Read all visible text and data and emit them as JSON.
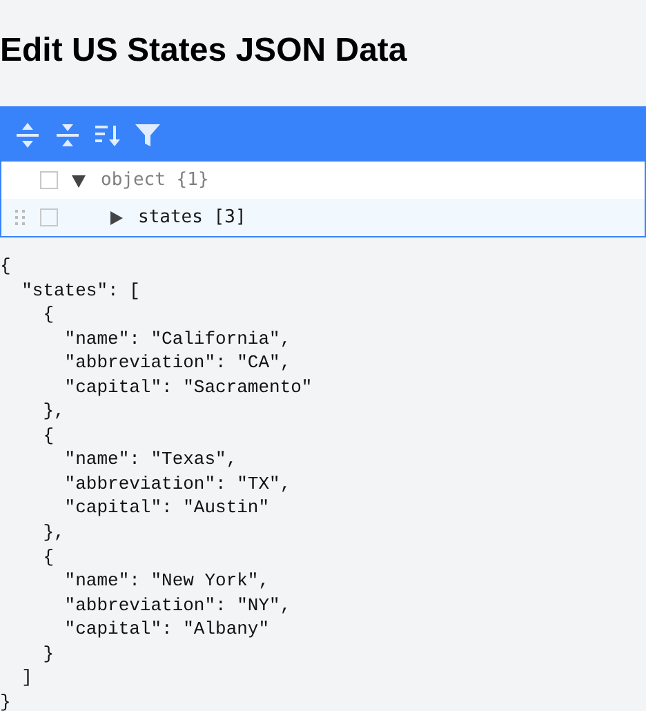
{
  "title": "Edit US States JSON Data",
  "toolbar": {
    "buttons": [
      {
        "kind": "expand"
      },
      {
        "kind": "collapse"
      },
      {
        "kind": "sort"
      },
      {
        "kind": "filter"
      }
    ]
  },
  "tree": [
    {
      "key": "object",
      "count": "{1}",
      "expanded": true,
      "highlighted": false,
      "checked": false,
      "children": [
        {
          "key": "states",
          "count": "[3]",
          "expanded": false,
          "highlighted": true,
          "checked": false
        }
      ]
    }
  ],
  "json_lines": [
    "{",
    "  \"states\": [",
    "    {",
    "      \"name\": \"California\",",
    "      \"abbreviation\": \"CA\",",
    "      \"capital\": \"Sacramento\"",
    "    },",
    "    {",
    "      \"name\": \"Texas\",",
    "      \"abbreviation\": \"TX\",",
    "      \"capital\": \"Austin\"",
    "    },",
    "    {",
    "      \"name\": \"New York\",",
    "      \"abbreviation\": \"NY\",",
    "      \"capital\": \"Albany\"",
    "    }",
    "  ]",
    "}"
  ]
}
